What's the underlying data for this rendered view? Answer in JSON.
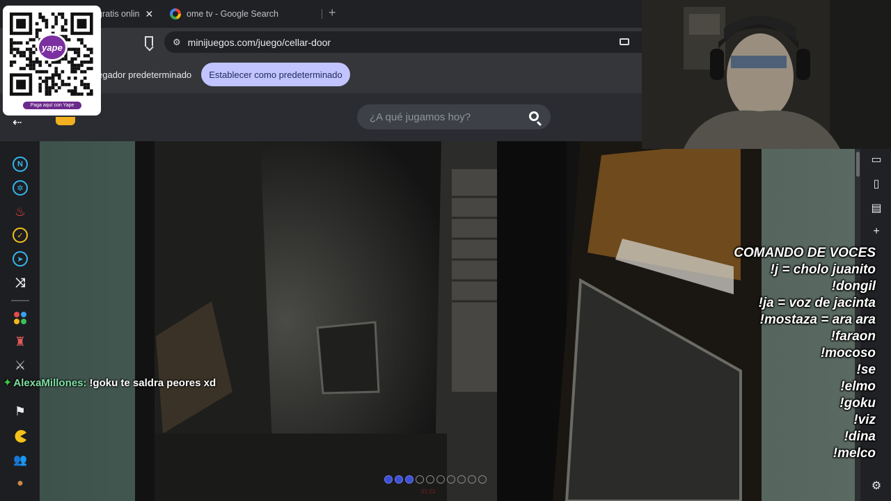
{
  "browser": {
    "active_tab_title": "gratis onlin",
    "other_tab_title": "ome tv - Google Search",
    "new_tab_label": "+",
    "close_label": "✕",
    "url": "minijuegos.com/juego/cellar-door"
  },
  "infobar": {
    "message": "egador predeterminado",
    "button_label": "Establecer como predeterminado"
  },
  "site": {
    "search_placeholder": "¿A qué jugamos hoy?",
    "back_label": "⇠"
  },
  "qr": {
    "badge_text": "yape",
    "footer_text": "Paga aquí con Yape"
  },
  "overlay": {
    "title": "COMANDO DE VOCES",
    "commands": [
      "!j = cholo juanito",
      "!dongil",
      "!ja = voz de jacinta",
      "!mostaza = ara ara",
      "!faraon",
      "!mocoso",
      "!se",
      "!elmo",
      "!goku",
      "!viz",
      "!dina",
      "!melco"
    ]
  },
  "chat": {
    "username": "AlexaMillones:",
    "message": "!goku te saldra peores xd"
  },
  "game": {
    "progress_filled": 3,
    "progress_total": 10,
    "label": "01:23"
  },
  "left_nav_icons": [
    "n-icon",
    "settings-hex-icon",
    "fire-icon",
    "check-badge-icon",
    "compass-icon",
    "shuffle-icon",
    "dots-grid-icon",
    "robot-icon",
    "swords-icon",
    "car-icon",
    "flag-icon",
    "pacman-icon",
    "people-icon",
    "bear-icon"
  ],
  "right_bar_icons": [
    "wallet-icon",
    "save-icon",
    "reader-icon",
    "add-icon",
    "settings-icon"
  ]
}
